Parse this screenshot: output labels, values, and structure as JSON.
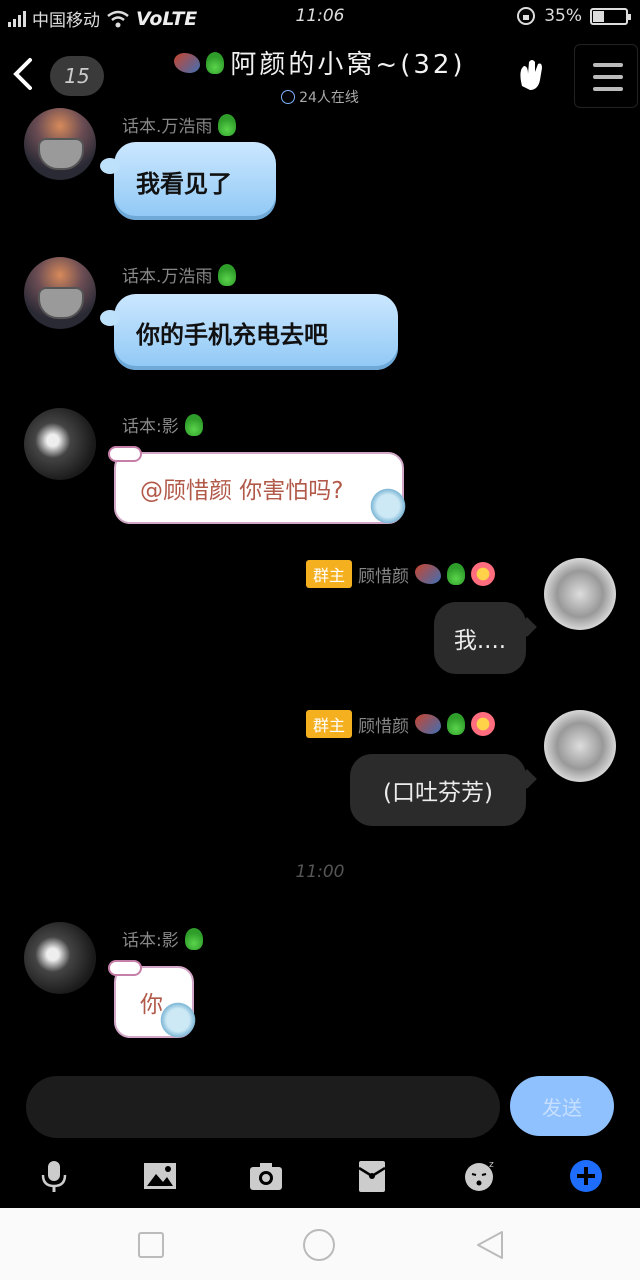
{
  "status_bar": {
    "carrier": "中国移动",
    "network": "VoLTE",
    "time": "11:06",
    "battery_text": "35%",
    "battery_level": 0.35
  },
  "header": {
    "unread_count": "15",
    "title": "阿颜的小窝~(32)",
    "online": "24人在线"
  },
  "messages": [
    {
      "sender": "话本.万浩雨",
      "text": "我看见了"
    },
    {
      "sender": "话本.万浩雨",
      "text": "你的手机充电去吧"
    },
    {
      "sender": "话本:影",
      "text": "@顾惜颜 你害怕吗?"
    },
    {
      "badge": "群主",
      "sender": "顾惜颜",
      "text": "我...."
    },
    {
      "badge": "群主",
      "sender": "顾惜颜",
      "text": "(口吐芬芳)"
    },
    {
      "sender": "话本:影",
      "text": "你"
    }
  ],
  "time_separator": "11:00",
  "composer": {
    "placeholder": "",
    "send_label": "发送"
  },
  "colors": {
    "accent_blue": "#1e6dff",
    "send_button": "#8fc1ff",
    "owner_badge": "#f5b020"
  },
  "icons": {
    "toolbar": [
      "microphone-icon",
      "image-icon",
      "camera-icon",
      "red-packet-icon",
      "emoji-icon",
      "plus-icon"
    ],
    "nav": [
      "recent-apps-icon",
      "home-icon",
      "back-icon"
    ]
  }
}
